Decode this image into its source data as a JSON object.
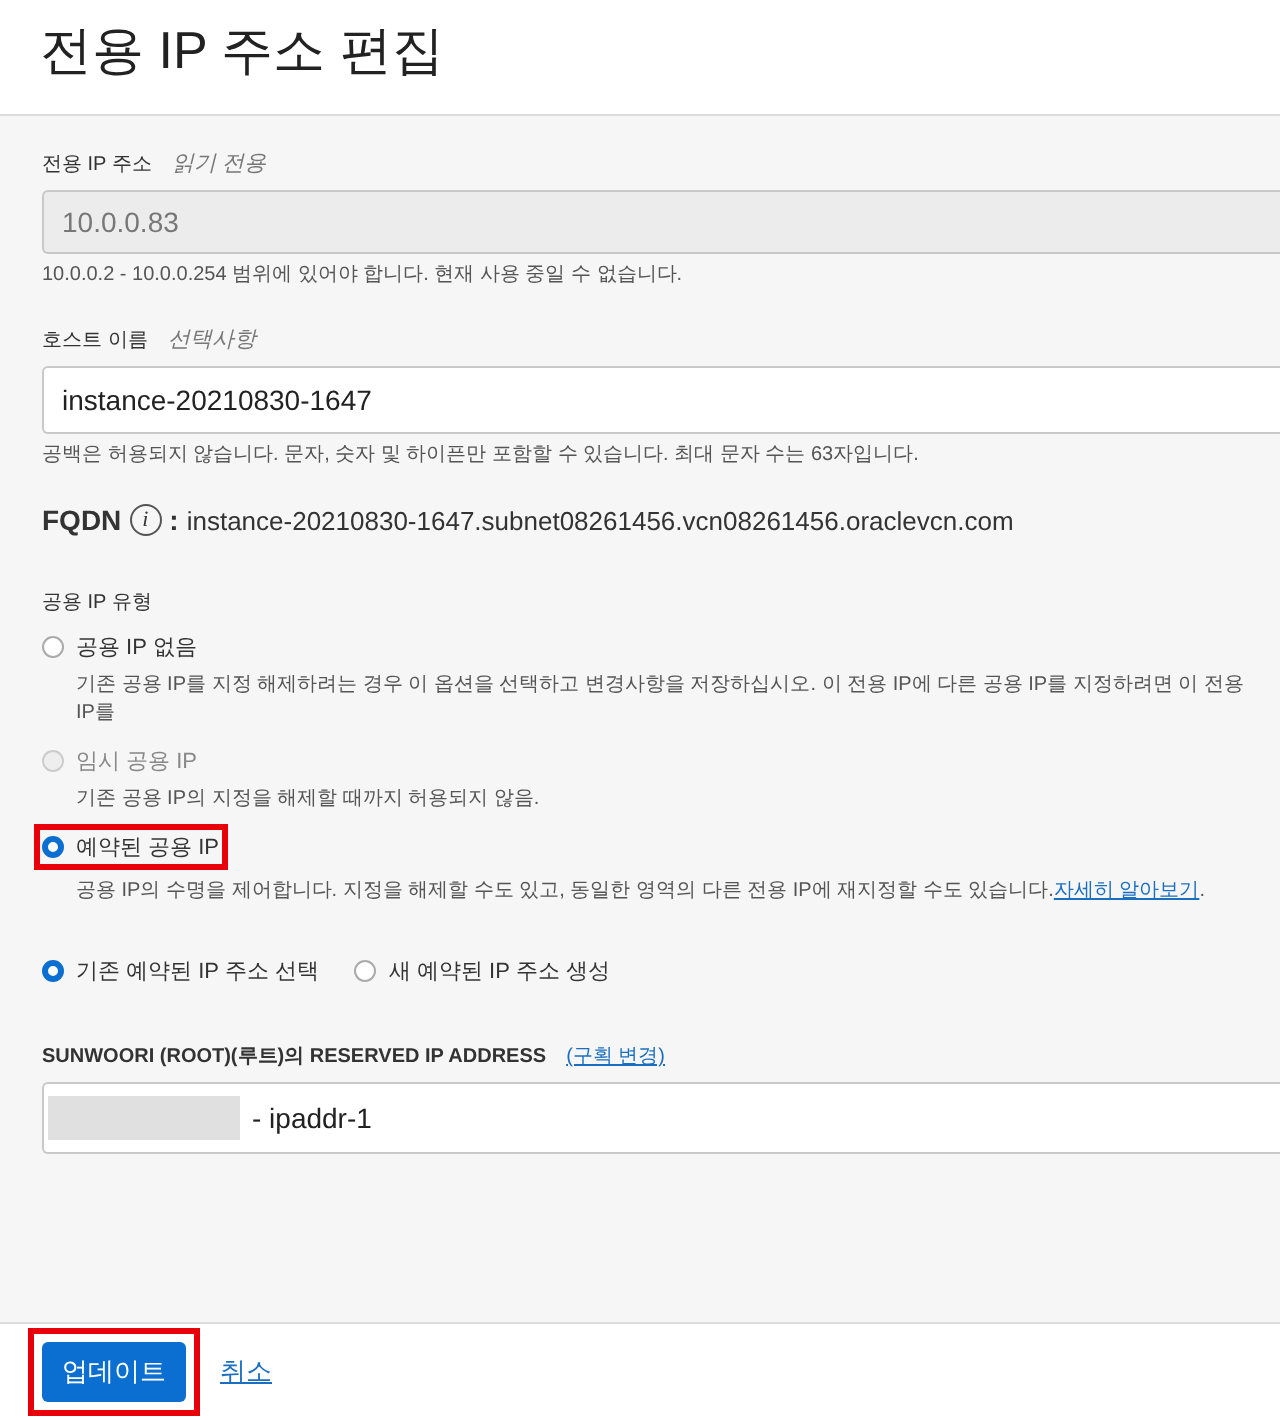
{
  "title": "전용 IP 주소 편집",
  "private_ip": {
    "label": "전용 IP 주소",
    "hint": "읽기 전용",
    "value": "10.0.0.83",
    "help": "10.0.0.2 - 10.0.0.254 범위에 있어야 합니다. 현재 사용 중일 수 없습니다."
  },
  "hostname": {
    "label": "호스트 이름",
    "hint": "선택사항",
    "value": "instance-20210830-1647",
    "help": "공백은 허용되지 않습니다. 문자, 숫자 및 하이픈만 포함할 수 있습니다. 최대 문자 수는 63자입니다."
  },
  "fqdn": {
    "label": "FQDN",
    "info_icon": "i",
    "separator": ":",
    "value": "instance-20210830-1647.subnet08261456.vcn08261456.oraclevcn.com"
  },
  "public_ip_type": {
    "label": "공용 IP 유형",
    "options": [
      {
        "label": "공용 IP 없음",
        "description": "기존 공용 IP를 지정 해제하려는 경우 이 옵션을 선택하고 변경사항을 저장하십시오. 이 전용 IP에 다른 공용 IP를 지정하려면 이 전용 IP를",
        "selected": false,
        "disabled": false,
        "highlighted": false
      },
      {
        "label": "임시 공용 IP",
        "description": "기존 공용 IP의 지정을 해제할 때까지 허용되지 않음.",
        "selected": false,
        "disabled": true,
        "highlighted": false
      },
      {
        "label": "예약된 공용 IP",
        "description": "공용 IP의 수명을 제어합니다. 지정을 해제할 수도 있고, 동일한 영역의 다른 전용 IP에 재지정할 수도 있습니다.",
        "link": "자세히 알아보기",
        "link_after": ".",
        "selected": true,
        "disabled": false,
        "highlighted": true
      }
    ]
  },
  "reserved_choice": [
    {
      "label": "기존 예약된 IP 주소 선택",
      "selected": true
    },
    {
      "label": "새 예약된 IP 주소 생성",
      "selected": false
    }
  ],
  "reserved_ip": {
    "label": "SUNWOORI (ROOT)(루트)의 RESERVED IP ADDRESS",
    "change_link": "(구획 변경)",
    "value": "- ipaddr-1"
  },
  "buttons": {
    "primary": "업데이트",
    "cancel": "취소",
    "primary_highlighted": true
  }
}
